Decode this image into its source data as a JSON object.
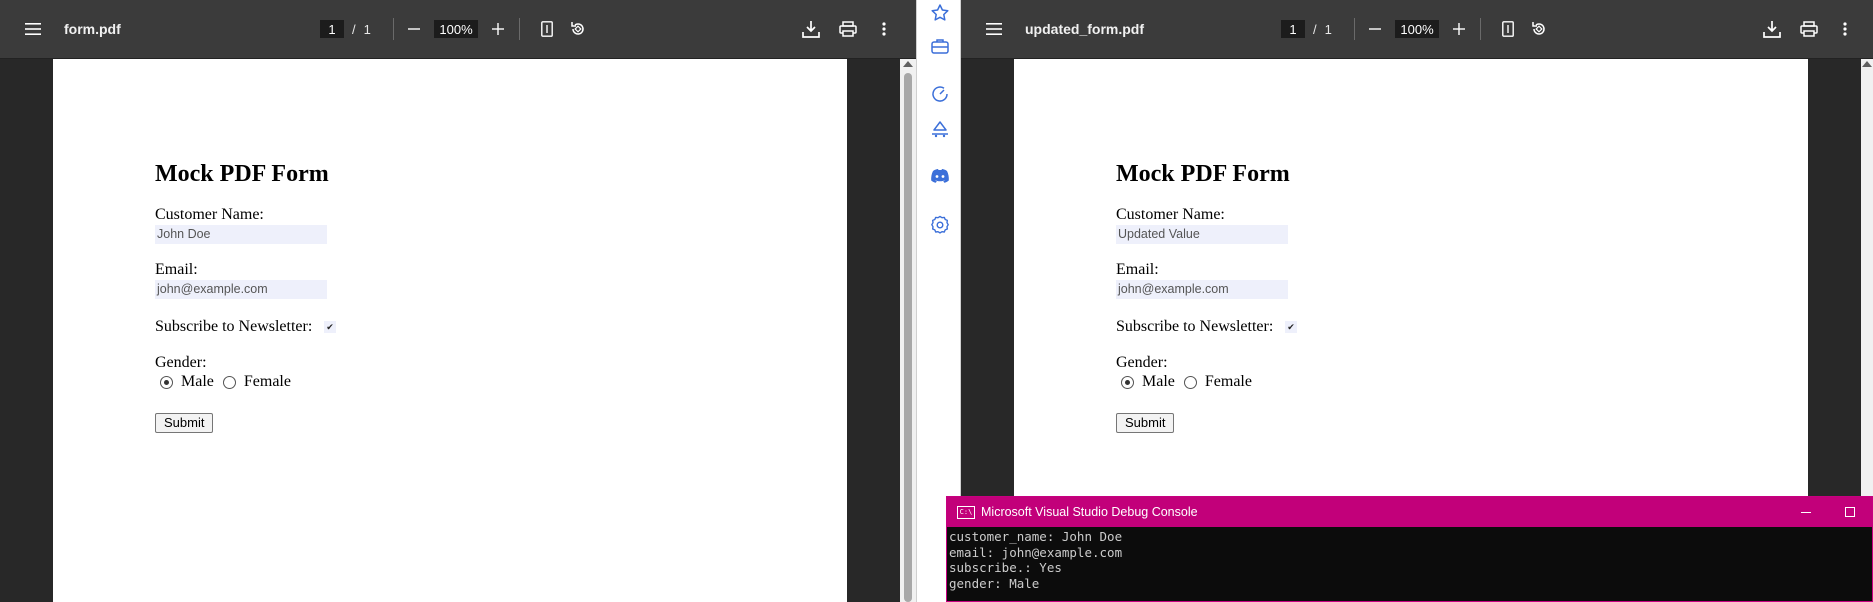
{
  "viewers": [
    {
      "title": "form.pdf",
      "page_current": "1",
      "page_sep": "/",
      "page_total": "1",
      "zoom": "100%",
      "form": {
        "heading": "Mock PDF Form",
        "name_label": "Customer Name:",
        "name_value": "John Doe",
        "email_label": "Email:",
        "email_value": "john@example.com",
        "subscribe_label": "Subscribe to Newsletter:",
        "subscribe_checked": true,
        "gender_label": "Gender:",
        "gender_options": [
          "Male",
          "Female"
        ],
        "gender_selected": "Male",
        "submit_label": "Submit"
      }
    },
    {
      "title": "updated_form.pdf",
      "page_current": "1",
      "page_sep": "/",
      "page_total": "1",
      "zoom": "100%",
      "form": {
        "heading": "Mock PDF Form",
        "name_label": "Customer Name:",
        "name_value": "Updated Value",
        "email_label": "Email:",
        "email_value": "john@example.com",
        "subscribe_label": "Subscribe to Newsletter:",
        "subscribe_checked": true,
        "gender_label": "Gender:",
        "gender_options": [
          "Male",
          "Female"
        ],
        "gender_selected": "Male",
        "submit_label": "Submit"
      }
    }
  ],
  "side_panel": {
    "icons": [
      "star-icon",
      "briefcase-icon",
      "gauge-icon",
      "paint-bucket-icon",
      "discord-icon",
      "settings-gear-icon"
    ],
    "accent_color": "#3b6fd9"
  },
  "console": {
    "title": "Microsoft Visual Studio Debug Console",
    "icon_text": "C:\\",
    "title_bar_color": "#c2007a",
    "lines": [
      "customer_name: John Doe",
      "email: john@example.com",
      "subscribe.: Yes",
      "gender: Male"
    ]
  }
}
